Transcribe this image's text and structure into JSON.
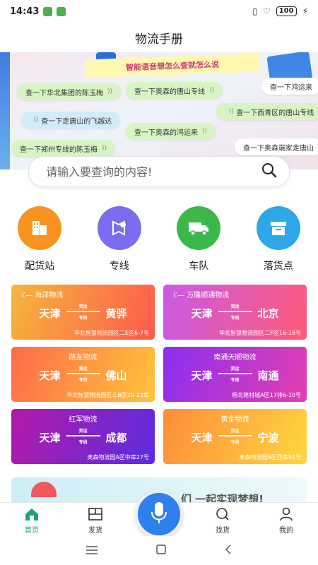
{
  "status_bar": {
    "time": "14:43",
    "battery": "100"
  },
  "page": {
    "title": "物流手册"
  },
  "banner": {
    "headline": "智能语音想怎么查就怎么说",
    "bubbles": [
      "查一下华北集团的陈玉梅",
      "查一下奥森的唐山专线",
      "查一下鸿运来",
      "查一下走唐山的飞越达",
      "查一下西青区的唐山专线",
      "查一下奥森的鸿运来",
      "查一下郑州专线的陈玉梅",
      "查一下奥森端家走唐山"
    ]
  },
  "search": {
    "placeholder": "请输入要查询的内容!"
  },
  "categories": [
    {
      "label": "配货站",
      "icon": "building-icon",
      "color": "#f7931e"
    },
    {
      "label": "专线",
      "icon": "route-pin-icon",
      "color": "#7b6cf0"
    },
    {
      "label": "车队",
      "icon": "truck-icon",
      "color": "#3cb84a"
    },
    {
      "label": "落货点",
      "icon": "box-icon",
      "color": "#2ea7e8"
    }
  ],
  "routes": [
    {
      "company": "海洋物流",
      "from": "天津",
      "to": "黄骅",
      "mid_top": "货运",
      "mid_bottom": "专线",
      "address": "华北智慧物流园区二E区6-7号"
    },
    {
      "company": "万隆顺通物流",
      "from": "天津",
      "to": "北京",
      "mid_top": "货运",
      "mid_bottom": "专线",
      "address": "华北智慧物流园区二F区16-18号"
    },
    {
      "company": "路友物流",
      "from": "天津",
      "to": "佛山",
      "mid_top": "货运",
      "mid_bottom": "专线",
      "address": "华北智慧物流园区三B区20-22库"
    },
    {
      "company": "南通天顺物流",
      "from": "天津",
      "to": "南通",
      "mid_top": "货运",
      "mid_bottom": "专线",
      "address": "杨北建材城A区17排6-10号"
    },
    {
      "company": "红军物流",
      "from": "天津",
      "to": "成都",
      "mid_top": "货运",
      "mid_bottom": "专线",
      "address": "奥森物流园A区中库27号"
    },
    {
      "company": "黄金物流",
      "from": "天津",
      "to": "宁波",
      "mid_top": "货运",
      "mid_bottom": "专线",
      "address": "奥森物流园A区西库51号"
    }
  ],
  "promo": {
    "text": "们 一起实现梦想!"
  },
  "tabbar": [
    {
      "label": "首页",
      "icon": "home-icon"
    },
    {
      "label": "发货",
      "icon": "ship-icon"
    },
    {
      "label": "找货",
      "icon": "find-icon"
    },
    {
      "label": "我的",
      "icon": "user-icon"
    }
  ],
  "colors": {
    "accent": "#1aa37f",
    "mic": "#2f80ee"
  }
}
